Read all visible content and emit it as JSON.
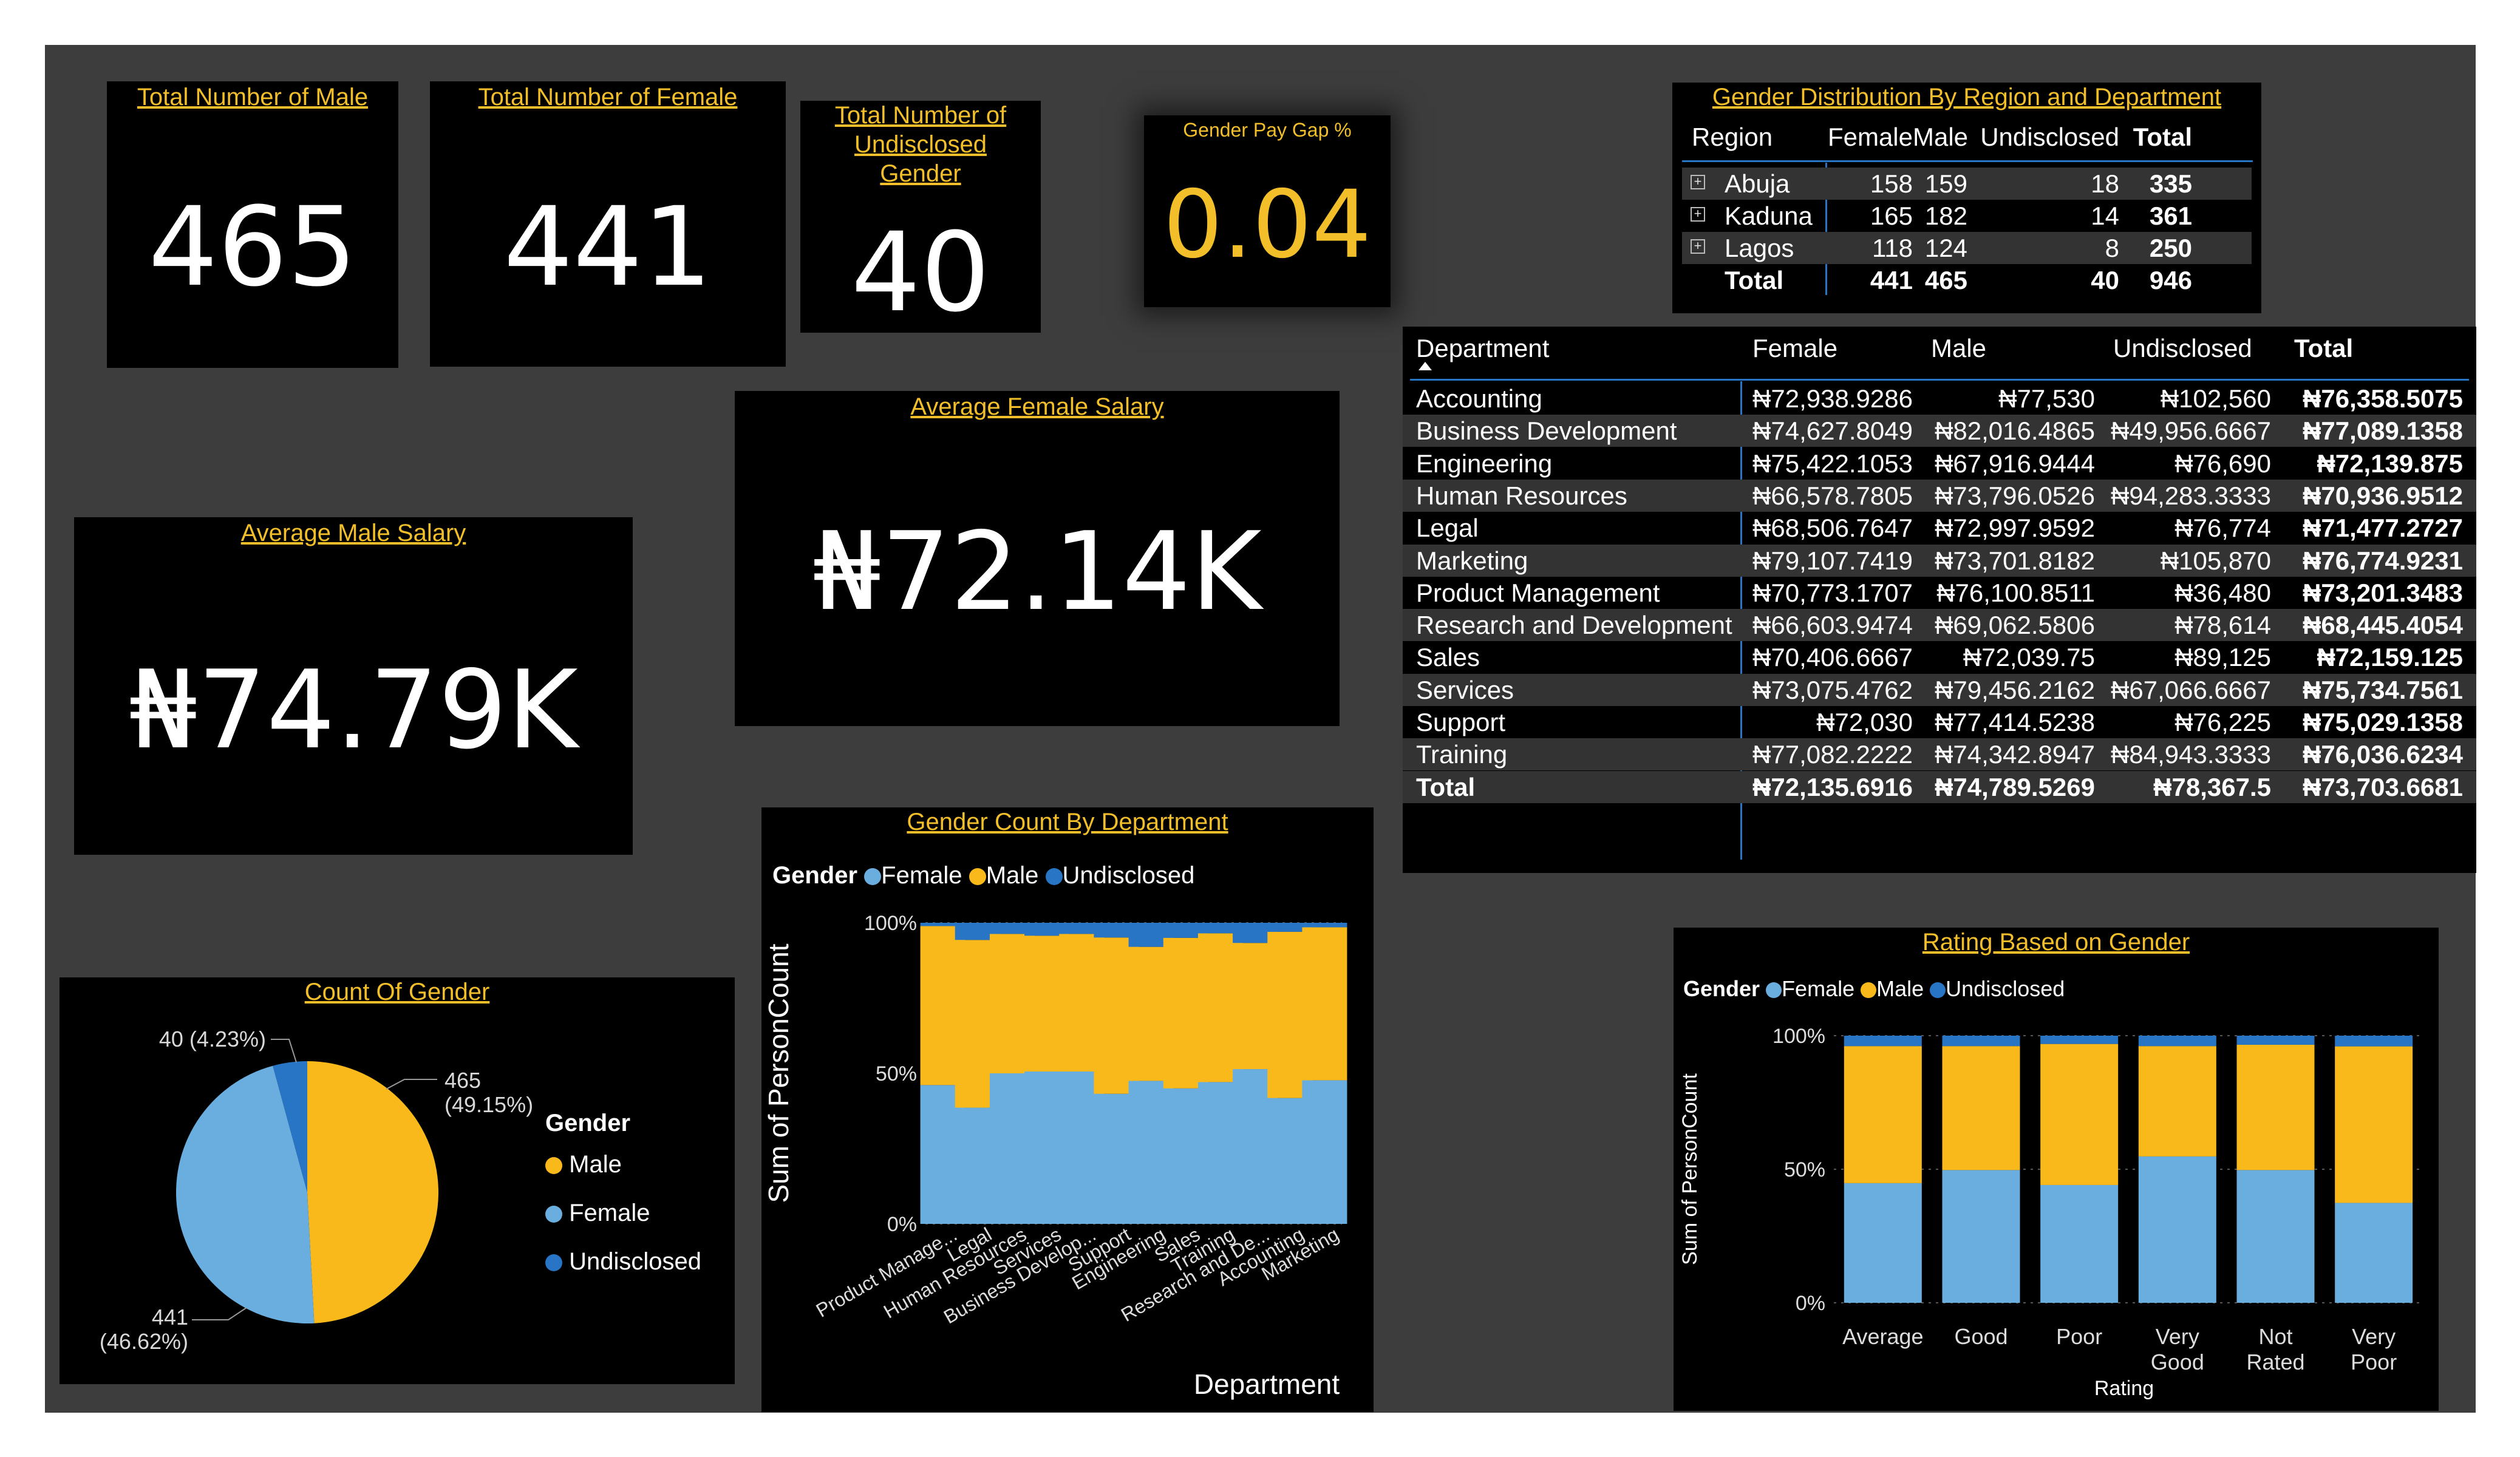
{
  "colors": {
    "female": "#6aaee0",
    "male": "#f9b91a",
    "undisclosed": "#2775c4",
    "title": "#f2bf2a",
    "panel": "#000000",
    "bg": "#3d3d3d"
  },
  "kpi": {
    "male": {
      "title": "Total Number of Male",
      "value": "465"
    },
    "female": {
      "title": "Total Number of Female",
      "value": "441"
    },
    "undisclosed": {
      "title": "Total Number of Undisclosed Gender",
      "value": "40"
    },
    "paygap": {
      "title": "Gender Pay Gap %",
      "value": "0.04"
    },
    "avg_female": {
      "title": "Average Female Salary",
      "value": "₦72.14K"
    },
    "avg_male": {
      "title": "Average Male Salary",
      "value": "₦74.79K"
    }
  },
  "region_table": {
    "title": "Gender Distribution By Region and Department",
    "headers": [
      "Region",
      "Female",
      "Male",
      "Undisclosed",
      "Total"
    ],
    "rows": [
      [
        "Abuja",
        "158",
        "159",
        "18",
        "335"
      ],
      [
        "Kaduna",
        "165",
        "182",
        "14",
        "361"
      ],
      [
        "Lagos",
        "118",
        "124",
        "8",
        "250"
      ]
    ],
    "total": [
      "Total",
      "441",
      "465",
      "40",
      "946"
    ],
    "expand_icon": "plus-box-icon"
  },
  "dept_table": {
    "headers": [
      "Department",
      "Female",
      "Male",
      "Undisclosed",
      "Total"
    ],
    "sort_icon": "sort-ascending-icon",
    "rows": [
      [
        "Accounting",
        "₦72,938.9286",
        "₦77,530",
        "₦102,560",
        "₦76,358.5075"
      ],
      [
        "Business Development",
        "₦74,627.8049",
        "₦82,016.4865",
        "₦49,956.6667",
        "₦77,089.1358"
      ],
      [
        "Engineering",
        "₦75,422.1053",
        "₦67,916.9444",
        "₦76,690",
        "₦72,139.875"
      ],
      [
        "Human Resources",
        "₦66,578.7805",
        "₦73,796.0526",
        "₦94,283.3333",
        "₦70,936.9512"
      ],
      [
        "Legal",
        "₦68,506.7647",
        "₦72,997.9592",
        "₦76,774",
        "₦71,477.2727"
      ],
      [
        "Marketing",
        "₦79,107.7419",
        "₦73,701.8182",
        "₦105,870",
        "₦76,774.9231"
      ],
      [
        "Product Management",
        "₦70,773.1707",
        "₦76,100.8511",
        "₦36,480",
        "₦73,201.3483"
      ],
      [
        "Research and Development",
        "₦66,603.9474",
        "₦69,062.5806",
        "₦78,614",
        "₦68,445.4054"
      ],
      [
        "Sales",
        "₦70,406.6667",
        "₦72,039.75",
        "₦89,125",
        "₦72,159.125"
      ],
      [
        "Services",
        "₦73,075.4762",
        "₦79,456.2162",
        "₦67,066.6667",
        "₦75,734.7561"
      ],
      [
        "Support",
        "₦72,030",
        "₦77,414.5238",
        "₦76,225",
        "₦75,029.1358"
      ],
      [
        "Training",
        "₦77,082.2222",
        "₦74,342.8947",
        "₦84,943.3333",
        "₦76,036.6234"
      ]
    ],
    "total": [
      "Total",
      "₦72,135.6916",
      "₦74,789.5269",
      "₦78,367.5",
      "₦73,703.6681"
    ]
  },
  "chart_data": [
    {
      "type": "pie",
      "title": "Count Of Gender",
      "legend_title": "Gender",
      "legend_position": "right",
      "slices": [
        {
          "name": "Male",
          "value": 465,
          "percent": "49.15%",
          "label": "465",
          "label_pct": "(49.15%)"
        },
        {
          "name": "Female",
          "value": 441,
          "percent": "46.62%",
          "label": "441",
          "label_pct": "(46.62%)"
        },
        {
          "name": "Undisclosed",
          "value": 40,
          "percent": "4.23%",
          "label": "40 (4.23%)",
          "label_pct": ""
        }
      ]
    },
    {
      "type": "bar",
      "stacked": "100%",
      "title": "Gender Count By Department",
      "xlabel": "Department",
      "ylabel": "Sum of PersonCount",
      "legend_title": "Gender",
      "legend_position": "top-left",
      "yticks": [
        "100%",
        "50%",
        "0%"
      ],
      "categories": [
        "Product Manage...",
        "Legal",
        "Human Resources",
        "Services",
        "Business Develop...",
        "Support",
        "Engineering",
        "Sales",
        "Training",
        "Research and De...",
        "Accounting",
        "Marketing"
      ],
      "series": [
        {
          "name": "Female",
          "values": [
            46.1,
            38.6,
            50.0,
            50.6,
            50.6,
            43.2,
            47.5,
            45.0,
            47.1,
            51.4,
            41.8,
            47.7
          ]
        },
        {
          "name": "Male",
          "values": [
            52.8,
            55.7,
            46.3,
            45.1,
            45.7,
            51.9,
            44.5,
            50.0,
            49.4,
            41.9,
            55.2,
            50.8
          ]
        },
        {
          "name": "Undisclosed",
          "values": [
            1.1,
            5.7,
            3.7,
            4.3,
            3.7,
            4.9,
            8.0,
            5.0,
            3.5,
            6.7,
            3.0,
            1.5
          ]
        }
      ],
      "ylim": [
        0,
        100
      ],
      "grid": true
    },
    {
      "type": "bar",
      "stacked": "100%",
      "title": "Rating Based on Gender",
      "xlabel": "Rating",
      "ylabel": "Sum of PersonCount",
      "legend_title": "Gender",
      "legend_position": "top-left",
      "yticks": [
        "100%",
        "50%",
        "0%"
      ],
      "categories": [
        "Average",
        "Good",
        "Poor",
        "Very Good",
        "Not Rated",
        "Very Poor"
      ],
      "series": [
        {
          "name": "Female",
          "values": [
            44.8,
            49.7,
            44.1,
            54.8,
            49.7,
            37.4
          ]
        },
        {
          "name": "Male",
          "values": [
            51.3,
            46.4,
            52.8,
            41.3,
            46.9,
            58.6
          ]
        },
        {
          "name": "Undisclosed",
          "values": [
            3.9,
            3.9,
            3.1,
            3.9,
            3.4,
            4.0
          ]
        }
      ],
      "ylim": [
        0,
        100
      ],
      "grid": true
    }
  ]
}
